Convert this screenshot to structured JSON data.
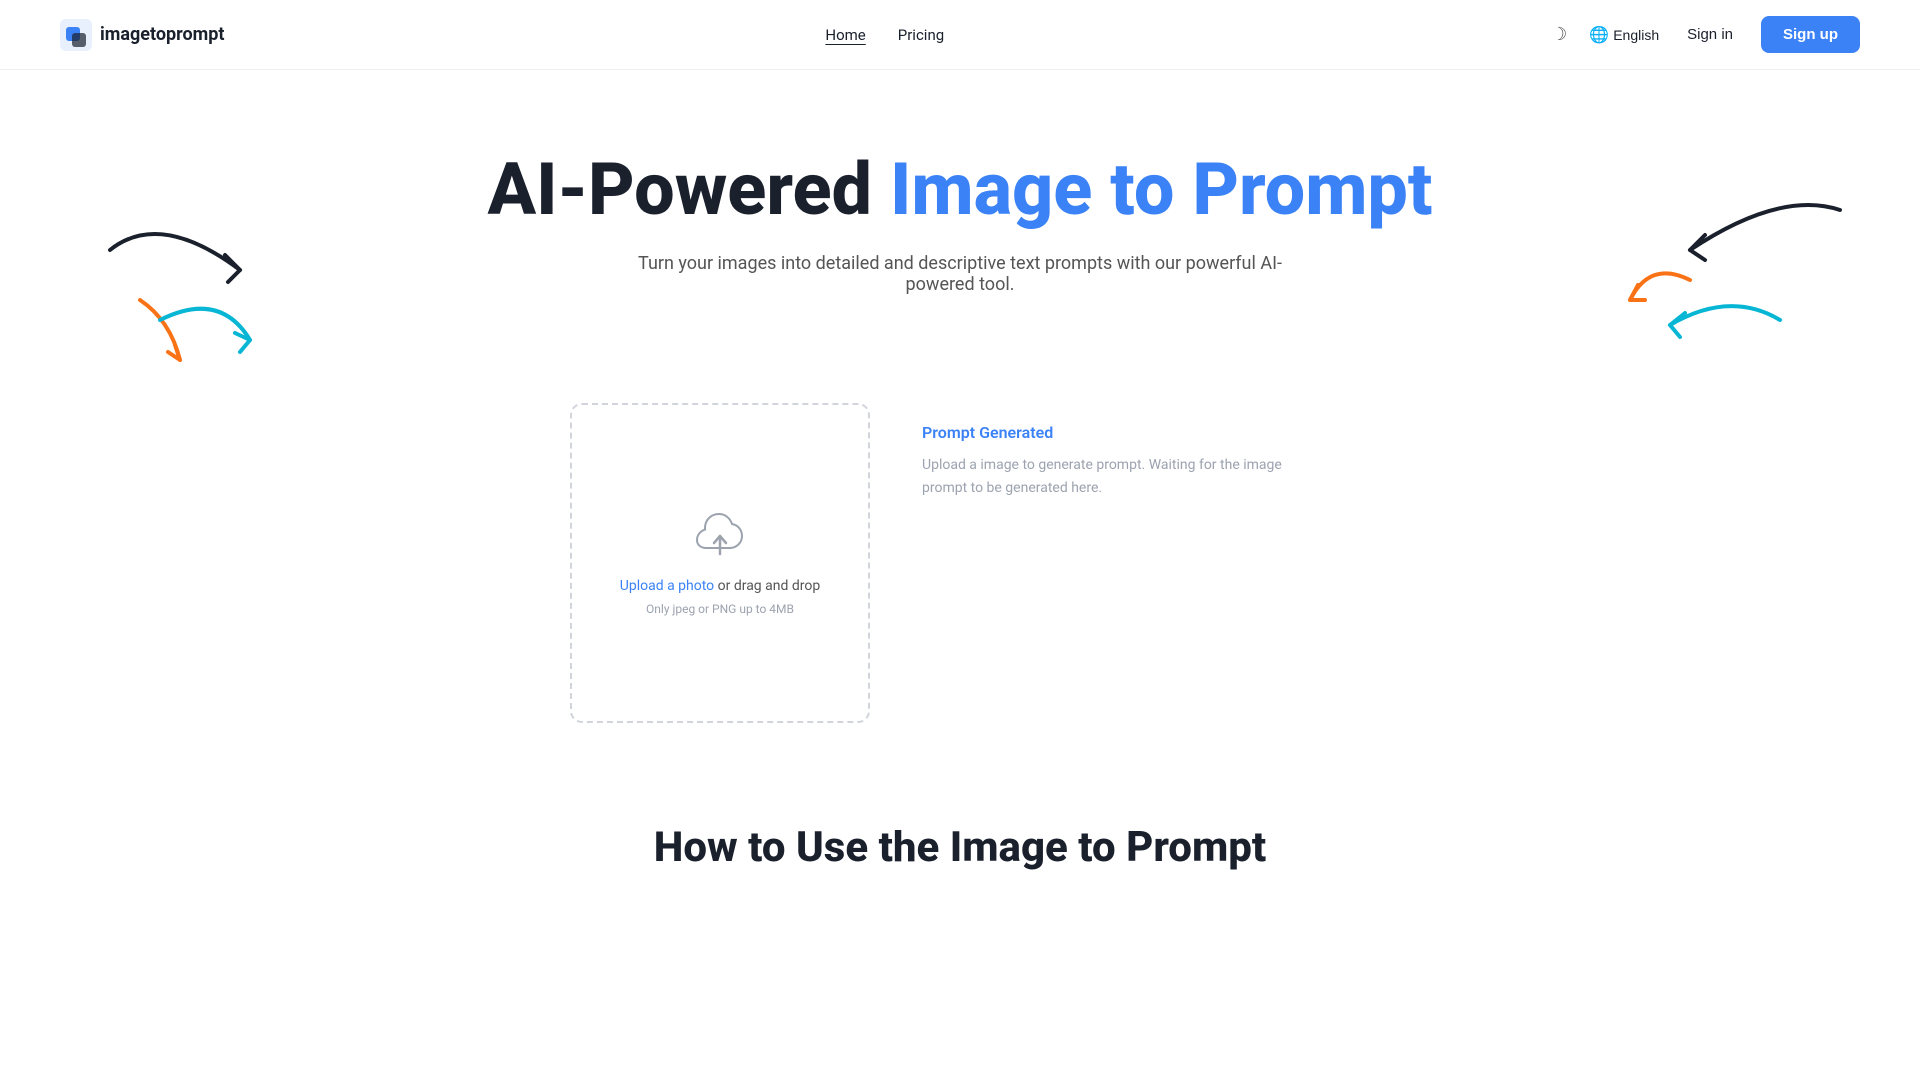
{
  "navbar": {
    "logo_text": "imagetoprompt",
    "nav_links": [
      {
        "label": "Home",
        "active": true
      },
      {
        "label": "Pricing",
        "active": false
      }
    ],
    "theme_icon": "☽",
    "language": "English",
    "signin_label": "Sign in",
    "signup_label": "Sign up"
  },
  "hero": {
    "title_black": "AI-Powered ",
    "title_blue": "Image to Prompt",
    "subtitle": "Turn your images into detailed and descriptive text prompts with our powerful AI-powered tool."
  },
  "upload_box": {
    "upload_link_text": "Upload a photo",
    "upload_text": " or drag and drop",
    "upload_hint": "Only jpeg or PNG up to 4MB"
  },
  "prompt_output": {
    "title": "Prompt Generated",
    "body": "Upload a image to generate prompt. Waiting for the image prompt to be generated here."
  },
  "how_to_section": {
    "title": "How to Use the Image to Prompt"
  }
}
